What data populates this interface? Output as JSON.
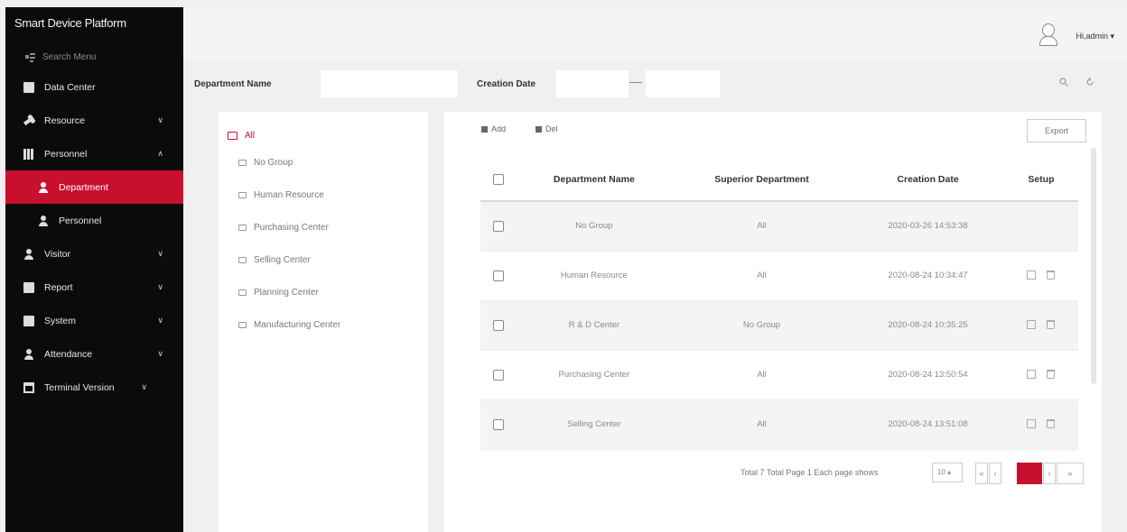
{
  "app": {
    "title": "Smart Device Platform"
  },
  "sidebar": {
    "search_placeholder": "Search Menu",
    "items": [
      {
        "label": "Data Center",
        "icon": "monitor-icon"
      },
      {
        "label": "Resource",
        "icon": "wrench-icon",
        "chevron": "down"
      },
      {
        "label": "Personnel",
        "icon": "grid-icon",
        "chevron": "up"
      },
      {
        "label": "Department",
        "icon": "department-icon",
        "active": true,
        "sub": true
      },
      {
        "label": "Personnel",
        "icon": "person-icon",
        "sub": true
      },
      {
        "label": "Visitor",
        "icon": "person-icon",
        "chevron": "down"
      },
      {
        "label": "Report",
        "icon": "monitor-icon",
        "chevron": "down"
      },
      {
        "label": "System",
        "icon": "monitor-icon",
        "chevron": "down"
      },
      {
        "label": "Attendance",
        "icon": "person-icon",
        "chevron": "down"
      },
      {
        "label": "Terminal Version",
        "icon": "calendar-icon",
        "chevron": "down"
      }
    ]
  },
  "header": {
    "user_label": "Hi,admin"
  },
  "filter": {
    "department_label": "Department Name",
    "department_value": "",
    "creation_label": "Creation Date",
    "date_start": "",
    "date_sep": "—",
    "date_end": ""
  },
  "tree": {
    "root": "All",
    "children": [
      "No Group",
      "Human Resource",
      "Purchasing Center",
      "Selling Center",
      "Planning Center",
      "Manufacturing Center"
    ]
  },
  "toolbar": {
    "add_label": "Add",
    "del_label": "Del",
    "export_label": "Export"
  },
  "table": {
    "columns": [
      "Department Name",
      "Superior Department",
      "Creation Date",
      "Setup"
    ],
    "rows": [
      {
        "name": "No Group",
        "superior": "All",
        "date": "2020-03-26 14:53:38",
        "actions": false
      },
      {
        "name": "Human Resource",
        "superior": "All",
        "date": "2020-08-24 10:34:47",
        "actions": true
      },
      {
        "name": "R & D Center",
        "superior": "No Group",
        "date": "2020-08-24 10:35:25",
        "actions": true
      },
      {
        "name": "Purchasing Center",
        "superior": "All",
        "date": "2020-08-24 13:50:54",
        "actions": true
      },
      {
        "name": "Selling Center",
        "superior": "All",
        "date": "2020-08-24 13:51:08",
        "actions": true
      }
    ]
  },
  "pagination": {
    "summary": "Total 7 Total Page 1 Each page shows",
    "page_size": "10"
  },
  "colors": {
    "accent": "#c8102e",
    "sidebar_bg": "#0b0b0b"
  }
}
